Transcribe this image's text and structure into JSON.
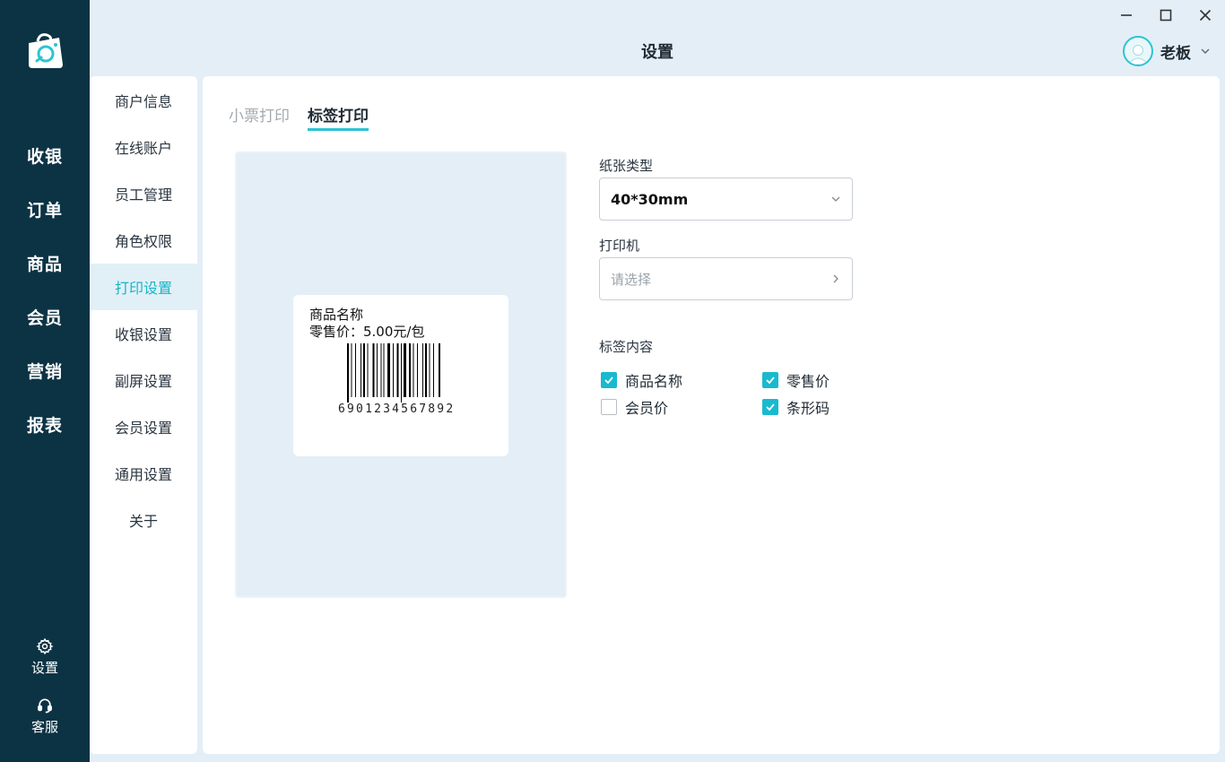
{
  "app": {
    "title": "设置"
  },
  "rail": {
    "items": [
      "收银",
      "订单",
      "商品",
      "会员",
      "营销",
      "报表"
    ],
    "settings_label": "设置",
    "service_label": "客服"
  },
  "user": {
    "name": "老板"
  },
  "menu": {
    "items": [
      "商户信息",
      "在线账户",
      "员工管理",
      "角色权限",
      "打印设置",
      "收银设置",
      "副屏设置",
      "会员设置",
      "通用设置",
      "关于"
    ],
    "active": "打印设置"
  },
  "tabs": [
    "小票打印",
    "标签打印"
  ],
  "active_tab": "标签打印",
  "preview": {
    "product_name": "商品名称",
    "price_line": "零售价：5.00元/包",
    "barcode_digits": "6901234567892"
  },
  "form": {
    "paper_type_label": "纸张类型",
    "paper_type_value": "40*30mm",
    "printer_label": "打印机",
    "printer_placeholder": "请选择",
    "content_label": "标签内容",
    "options": [
      {
        "label": "商品名称",
        "checked": true
      },
      {
        "label": "零售价",
        "checked": true
      },
      {
        "label": "会员价",
        "checked": false
      },
      {
        "label": "条形码",
        "checked": true
      }
    ]
  },
  "colors": {
    "rail_bg": "#0c3344",
    "accent": "#19b9cf",
    "page_bg": "#e4eef6"
  }
}
